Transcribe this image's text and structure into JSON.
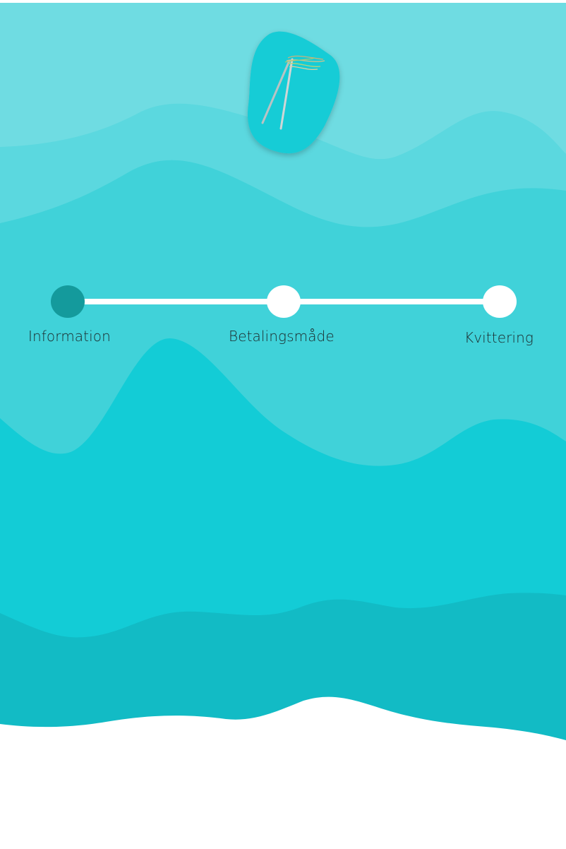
{
  "colors": {
    "wave_top": "#6fdce2",
    "wave_2": "#5bd8df",
    "wave_3": "#40d2d9",
    "wave_4": "#13ccd6",
    "wave_5": "#12bbc5",
    "logo_blob": "#14ccd6",
    "step_active": "#149a9c",
    "step_inactive": "#ffffff"
  },
  "logo": {
    "icon": "kite-icon"
  },
  "stepper": {
    "active_step": 1,
    "steps": [
      {
        "label": "Information"
      },
      {
        "label": "Betalingsmåde"
      },
      {
        "label": "Kvittering"
      }
    ]
  }
}
